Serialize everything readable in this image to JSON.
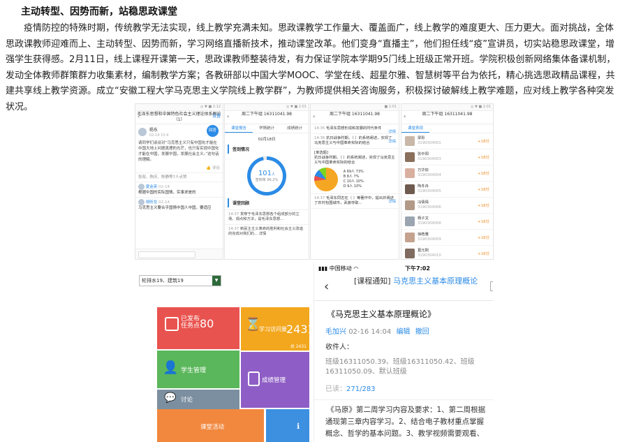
{
  "article": {
    "heading": "主动转型、因势而新，站稳思政课堂",
    "paragraph": "疫情防控的特殊时期，传统教学无法实现，线上教学充满未知。思政课教学工作量大、覆盖面广，线上教学的难度更大、压力更大。面对挑战，全体思政课教师迎难而上、主动转型、因势而新，学习网络直播新技术，推动课堂改革。他们变身“直播主”，他们担任线“疫”宣讲员，切实站稳思政课堂，增强学生获得感。2月11日，线上课程开课第一天，思政课教师整装待发，有力保证学院本学期95门线上班级正常开班。学院积极创新网络集体备课机制，发动全体教师群策群力收集素材，编制教学方案；各教研部以中国大学MOOC、学堂在线、超星尔雅、智慧树等平台为依托，精心挑选思政精品课程，共建共享线上教学资源。成立“安徽工程大学马克思主义学院线上教学群”，为教师提供相关咨询服务，积极探讨破解线上教学难题，应对线上教学各种突发状况。"
  },
  "phone1": {
    "status": "◎ ▼ ■ 2:12",
    "nav_title": "毛泽东思想和中国特色社会主义理论体系概论（1）",
    "nav_action": "设置",
    "author": "杨东",
    "author_time": "02-14 15:4",
    "body": "请同学们谈谈对“马克思主义只有中国化才能在中国大地上问题真理的光芒，也只有实现中国化才能在中国，发展中国，发展社会主义。”这句话的理解。",
    "fab": "回答",
    "tags": "👍 评论",
    "likes_row": "张双、陈庆、陈静等7人点赞",
    "comments": [
      {
        "name": "夏金英",
        "time": "02-14",
        "text": "根据中国的实际国情，实事求是的"
      },
      {
        "name": "胡昕龙",
        "time": "02-14",
        "text": "马克思主义要合乎国情中国人中国，要适应"
      }
    ]
  },
  "phone2": {
    "status": "◎ ▼ ■ 2:01",
    "nav_title": "周二下午组 16311041.98",
    "tabs": [
      "课堂报告",
      "学情统计",
      "成绩统计"
    ],
    "date": "02月18日",
    "section1": "签到情况",
    "ring_value": "101",
    "ring_unit": "人",
    "ring_label": "签到率",
    "ring_pct": "96.2%",
    "section2": "课堂回顾",
    "items": [
      {
        "time": "14:37",
        "text": "贯穿于毛泽东思想各个组成部分的立场、观点和方法，是毛泽东思想..."
      },
      {
        "time": "14:37",
        "text": "新民主主义革命的胜利和社会主义改造的完成对我们的... 详情"
      }
    ]
  },
  "phone3": {
    "status": "■ 2:01",
    "nav_title": "周二下午组 16311041.98",
    "questions": [
      {
        "time": "14:35",
        "text": "毛泽东思想形成和发展的时代条件",
        "more": "详情"
      },
      {
        "time": "14:36",
        "text": "抗日战争时期，（ ）的系统阐述，实现了马克思主义与中国革命实际的结合",
        "more": "详情"
      },
      {
        "time": "14:37",
        "text": "毛泽东同志在（ ）等著作中，提出并阐述了农村包围城市，武装夺取...",
        "more": "详情"
      }
    ],
    "poll_title": "[单选题]",
    "poll_text": "抗日战争时期，（ ）的系统阐述，实现了马克思主义与中国革命实际的结合",
    "legend": [
      "A 69人 73%",
      "B 8人 7%",
      "C 10人 10%",
      "D 9人 10%"
    ],
    "chart_data": {
      "type": "pie",
      "categories": [
        "A",
        "B",
        "C",
        "D"
      ],
      "values": [
        73,
        7,
        10,
        10
      ],
      "colors": [
        "#f5a623",
        "#e94e4e",
        "#2b8be6",
        "#7ed321"
      ]
    }
  },
  "phone4": {
    "status": "◎ ▼ ■ 2:01",
    "nav_title": "周二下午组 16311041.98",
    "tab": "课堂表现",
    "students": [
      {
        "name": "梁彤",
        "id": "3190304001",
        "score": "+18分"
      },
      {
        "name": "张中阳",
        "id": "3190304003",
        "score": "+18分"
      },
      {
        "name": "万华钦",
        "id": "3190304004",
        "score": "+18分"
      },
      {
        "name": "陶冬舟",
        "id": "3190304005",
        "score": "+18分"
      },
      {
        "name": "冯倩倩",
        "id": "3190304006",
        "score": "+18分"
      },
      {
        "name": "杨子文",
        "id": "3190304008",
        "score": "+18分"
      },
      {
        "name": "徐皓雅",
        "id": "3190304009",
        "score": "+18分"
      },
      {
        "name": "葛元刚",
        "id": "3190304010",
        "score": "+18分"
      },
      {
        "name": "王珍",
        "id": "3190304011",
        "score": "+18分"
      }
    ]
  },
  "dashboard": {
    "filter": "轮排水19、建筑19",
    "tiles": {
      "tasks": {
        "label": "已发布\n任务点",
        "value": "80"
      },
      "visits": {
        "label": "学习访问量",
        "value": "2431",
        "sub": "总 2431"
      },
      "students": {
        "label": "学生管理"
      },
      "discuss": {
        "label": "讨论"
      },
      "grades": {
        "label": "成绩管理"
      },
      "activity": {
        "label": "课堂活动"
      }
    },
    "colors": {
      "red": "#e9534f",
      "yellow": "#f3a71e",
      "green": "#5bb75b",
      "gray": "#7c8fa0",
      "purple": "#8e5ec6",
      "orange": "#f1883e",
      "blue": "#3d8fe0"
    }
  },
  "notice": {
    "carrier": "▮▮▮ 中国移动 ◠",
    "time": "下午7:02",
    "nav_prefix": "[课程通知]",
    "nav_title": "马克思主义基本原理概论",
    "title": "《马克思主义基本原理概论》",
    "author": "毛加兴",
    "date": "02-16 14:04",
    "edit": "编辑",
    "withdraw": "撤回",
    "recipients_label": "收件人：",
    "recipients": "班级16311050.39、班级16311050.42、班级16311050.09、默认班级",
    "read_label": "已读：",
    "read_count": "271/283",
    "description": "《马原》第二周学习内容及要求：1、第二周根据通现第三章内容学习。2、结合电子教材重点掌握概念、哲学的基本问题。3、教学视频需要观看、"
  }
}
